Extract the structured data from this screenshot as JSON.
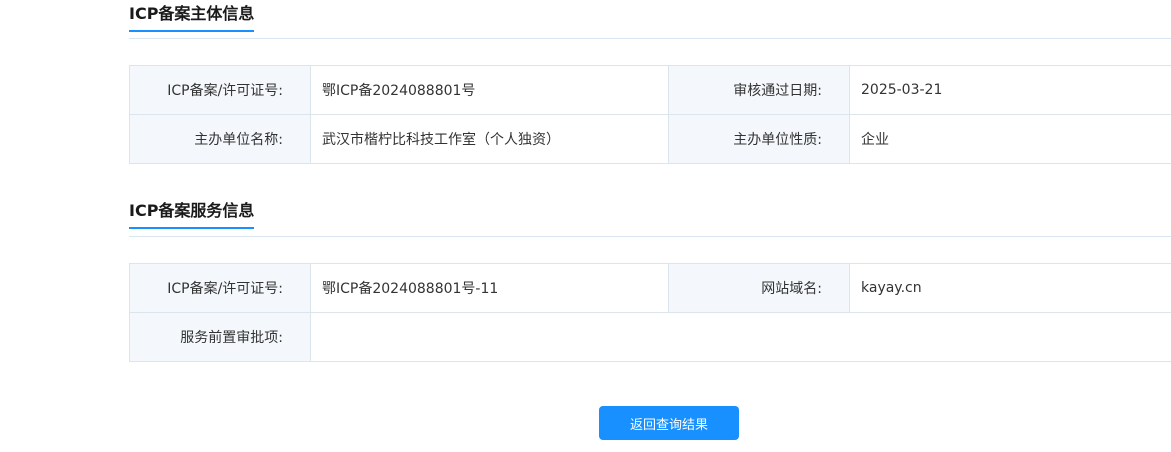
{
  "subject": {
    "title": "ICP备案主体信息",
    "license_label": "ICP备案/许可证号:",
    "license_value": "鄂ICP备2024088801号",
    "audit_date_label": "审核通过日期:",
    "audit_date_value": "2025-03-21",
    "org_name_label": "主办单位名称:",
    "org_name_value": "武汉市楷柠比科技工作室（个人独资）",
    "org_type_label": "主办单位性质:",
    "org_type_value": "企业"
  },
  "service": {
    "title": "ICP备案服务信息",
    "license_label": "ICP备案/许可证号:",
    "license_value": "鄂ICP备2024088801号-11",
    "domain_label": "网站域名:",
    "domain_value": "kayay.cn",
    "preapproval_label": "服务前置审批项:",
    "preapproval_value": ""
  },
  "actions": {
    "back_label": "返回查询结果"
  },
  "colors": {
    "accent": "#1890ff",
    "label_bg": "#f4f8fc",
    "border": "#dde5ec"
  }
}
